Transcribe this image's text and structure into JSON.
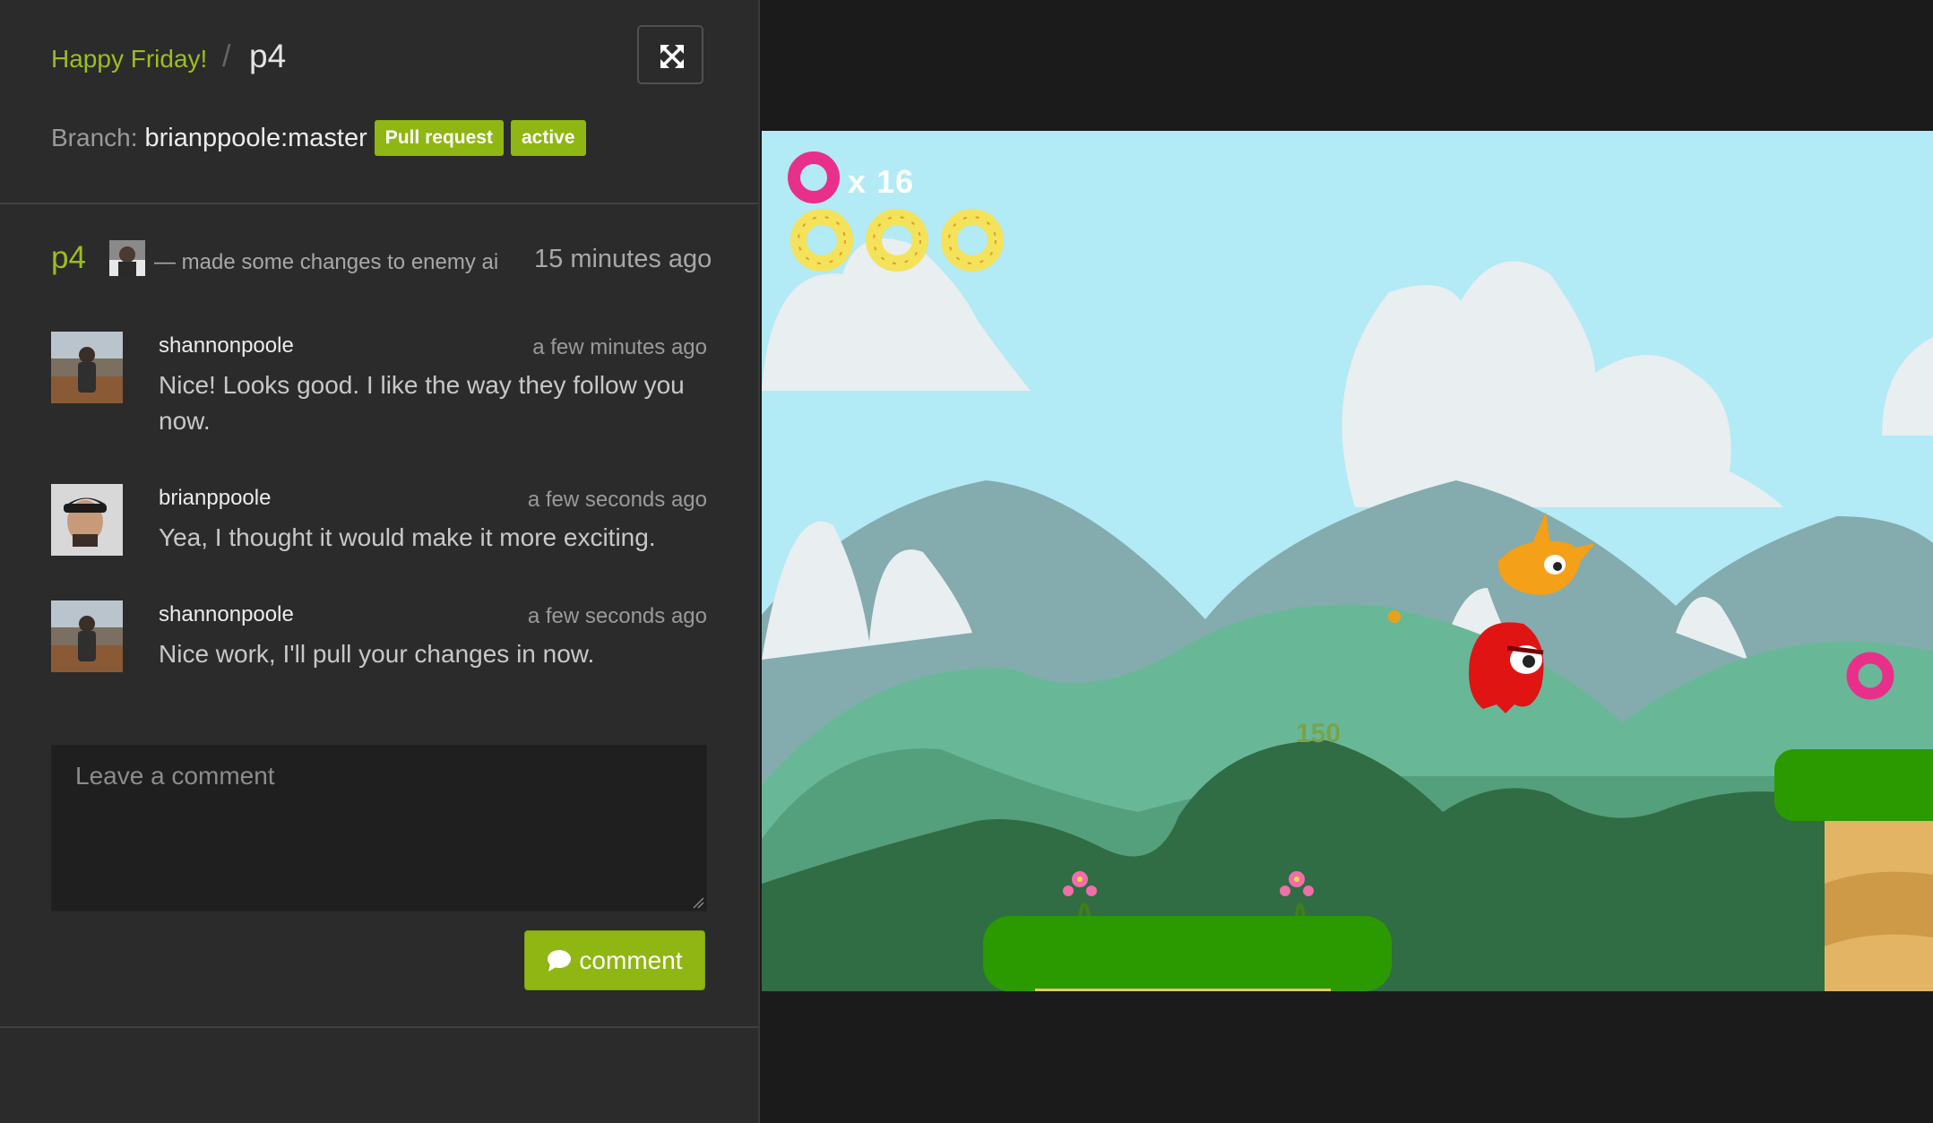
{
  "header": {
    "project_name": "Happy Friday!",
    "separator": "/",
    "build_name": "p4",
    "expand_icon": "expand-arrows-icon"
  },
  "branch": {
    "label": "Branch:",
    "value": "brianppoole:master",
    "tags": [
      "Pull request",
      "active"
    ]
  },
  "commit": {
    "id": "p4",
    "message": "— made some changes to enemy ai",
    "time": "15 minutes ago"
  },
  "comments": [
    {
      "author": "shannonpoole",
      "time": "a few minutes ago",
      "text": "Nice! Looks good. I like the way they follow you now."
    },
    {
      "author": "brianppoole",
      "time": "a few seconds ago",
      "text": "Yea, I thought it would make it more exciting."
    },
    {
      "author": "shannonpoole",
      "time": "a few seconds ago",
      "text": "Nice work, I'll pull your changes in now."
    }
  ],
  "comment_form": {
    "placeholder": "Leave a comment",
    "submit_label": "comment",
    "submit_icon": "speech-bubble-icon"
  },
  "game": {
    "donut_count": "x 16",
    "lives": 3,
    "score_popup": "150",
    "colors": {
      "sky": "#b2eaf5",
      "ground": "#2b9a00",
      "accent": "#8fb613"
    }
  }
}
